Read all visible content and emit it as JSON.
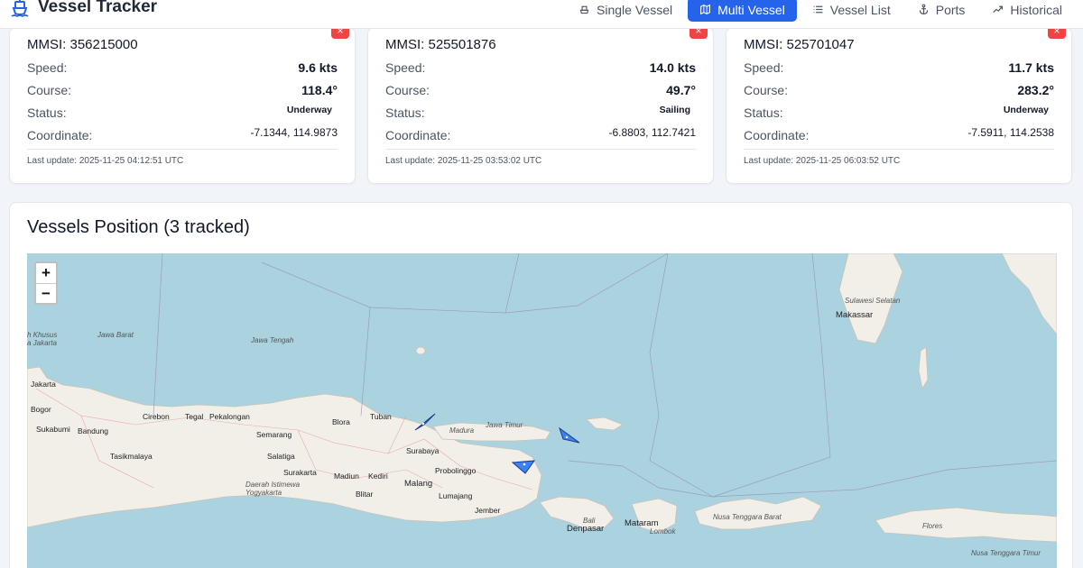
{
  "app": {
    "title": "Vessel Tracker"
  },
  "nav": {
    "items": [
      {
        "label": "Single Vessel",
        "icon": "ship-icon",
        "active": false
      },
      {
        "label": "Multi Vessel",
        "icon": "map-icon",
        "active": true
      },
      {
        "label": "Vessel List",
        "icon": "list-icon",
        "active": false
      },
      {
        "label": "Ports",
        "icon": "anchor-icon",
        "active": false
      },
      {
        "label": "Historical",
        "icon": "trend-icon",
        "active": false
      }
    ]
  },
  "vessels": [
    {
      "mmsi": "MMSI: 356215000",
      "close": "×",
      "speed_label": "Speed:",
      "speed": "9.6 kts",
      "course_label": "Course:",
      "course": "118.4°",
      "status_label": "Status:",
      "status": "Underway",
      "coord_label": "Coordinate:",
      "coord": "-7.1344, 114.9873",
      "updated": "Last update: 2025-11-25 04:12:51 UTC"
    },
    {
      "mmsi": "MMSI: 525501876",
      "close": "×",
      "speed_label": "Speed:",
      "speed": "14.0 kts",
      "course_label": "Course:",
      "course": "49.7°",
      "status_label": "Status:",
      "status": "Sailing",
      "coord_label": "Coordinate:",
      "coord": "-6.8803, 112.7421",
      "updated": "Last update: 2025-11-25 03:53:02 UTC"
    },
    {
      "mmsi": "MMSI: 525701047",
      "close": "×",
      "speed_label": "Speed:",
      "speed": "11.7 kts",
      "course_label": "Course:",
      "course": "283.2°",
      "status_label": "Status:",
      "status": "Underway",
      "coord_label": "Coordinate:",
      "coord": "-7.5911, 114.2538",
      "updated": "Last update: 2025-11-25 06:03:52 UTC"
    }
  ],
  "map": {
    "title": "Vessels Position (3 tracked)",
    "zoom_in": "+",
    "zoom_out": "−",
    "colors": {
      "water": "#aad3df",
      "land": "#f2efe9",
      "vessel_fill": "#3b82f6",
      "vessel_stroke": "#1e3a8a"
    },
    "places": {
      "sulawesi": "Sulawesi Selatan",
      "makassar": "Makassar",
      "khusus": "h Khusus a Jakarta",
      "jawa_barat": "Jawa Barat",
      "jawa_tengah": "Jawa Tengah",
      "jakarta": "Jakarta",
      "bogor": "Bogor",
      "sukabumi": "Sukabumi",
      "bandung": "Bandung",
      "tasikmalaya": "Tasikmalaya",
      "cirebon": "Cirebon",
      "tegal": "Tegal",
      "pekalongan": "Pekalongan",
      "semarang": "Semarang",
      "salatiga": "Salatiga",
      "surakarta": "Surakarta",
      "yogyakarta": "Daerah Istimewa Yogyakarta",
      "blora": "Blora",
      "tuban": "Tuban",
      "surabaya": "Surabaya",
      "madiun": "Madiun",
      "kediri": "Kediri",
      "blitar": "Blitar",
      "malang": "Malang",
      "lumajang": "Lumajang",
      "jember": "Jember",
      "probolinggo": "Probolinggo",
      "madura": "Madura",
      "jawa_timur": "Jawa Timur",
      "bali": "Bali",
      "denpasar": "Denpasar",
      "mataram": "Mataram",
      "lombok": "Lombok",
      "ntb": "Nusa Tenggara Barat",
      "flores": "Flores",
      "ntt": "Nusa Tenggara Timur"
    }
  }
}
